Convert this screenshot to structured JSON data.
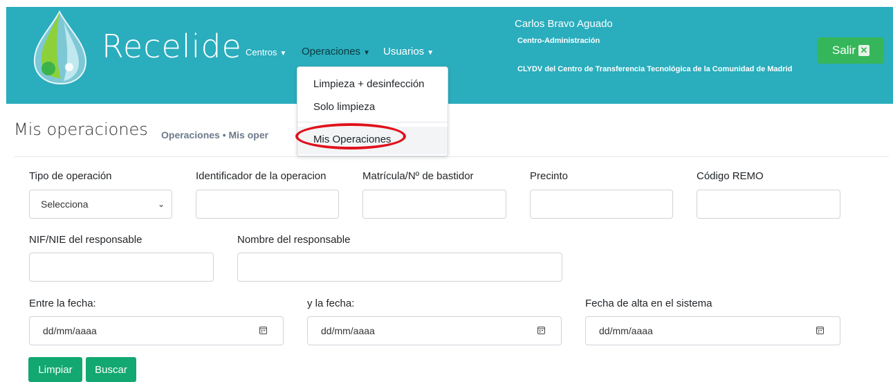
{
  "header": {
    "brand": "Recelide",
    "nav": {
      "centros": "Centros",
      "operaciones": "Operaciones",
      "usuarios": "Usuarios"
    },
    "user": {
      "name": "Carlos Bravo Aguado",
      "role": "Centro-Administración",
      "organization": "CLYDV del Centro de Transferencia Tecnológica de la Comunidad de Madrid"
    },
    "logout_label": "Salir",
    "logout_icon": "close-icon",
    "colors": {
      "header_bg": "#2aadbd",
      "logout_bg": "#36b65a"
    }
  },
  "dropdown": {
    "items": [
      "Limpieza + desinfección",
      "Solo limpieza",
      "Mis Operaciones"
    ],
    "highlighted_item": "Mis Operaciones",
    "highlight_color": "#e0111b"
  },
  "page": {
    "title": "Mis operaciones",
    "breadcrumb": "Operaciones • Mis oper"
  },
  "form": {
    "tipo_label": "Tipo de operación",
    "tipo_value": "Selecciona",
    "identificador_label": "Identificador de la operacion",
    "matricula_label": "Matrícula/Nº de bastidor",
    "precinto_label": "Precinto",
    "remo_label": "Código REMO",
    "nif_label": "NIF/NIE del responsable",
    "nombre_label": "Nombre del responsable",
    "fecha_desde_label": "Entre la fecha:",
    "fecha_hasta_label": "y la fecha:",
    "fecha_alta_label": "Fecha de alta en el sistema",
    "date_placeholder": "dd/mm/aaaa"
  },
  "actions": {
    "limpiar": "Limpiar",
    "buscar": "Buscar",
    "color": "#13a871"
  }
}
